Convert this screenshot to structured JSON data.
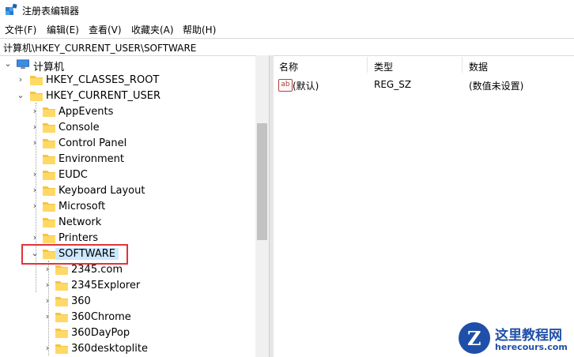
{
  "window": {
    "title": "注册表编辑器"
  },
  "menu": [
    "文件(F)",
    "编辑(E)",
    "查看(V)",
    "收藏夹(A)",
    "帮助(H)"
  ],
  "address": "计算机\\HKEY_CURRENT_USER\\SOFTWARE",
  "tree": {
    "root": "计算机",
    "hkcr": "HKEY_CLASSES_ROOT",
    "hkcu": "HKEY_CURRENT_USER",
    "hkcu_children": [
      "AppEvents",
      "Console",
      "Control Panel",
      "Environment",
      "EUDC",
      "Keyboard Layout",
      "Microsoft",
      "Network",
      "Printers"
    ],
    "selected": "SOFTWARE",
    "software_children": [
      "2345.com",
      "2345Explorer",
      "360",
      "360Chrome",
      "360DayPop",
      "360desktoplite"
    ]
  },
  "list": {
    "headers": {
      "name": "名称",
      "type": "类型",
      "data": "数据"
    },
    "rows": [
      {
        "name": "(默认)",
        "type": "REG_SZ",
        "data": "(数值未设置)",
        "icon": "ab-icon"
      }
    ]
  },
  "watermark": {
    "name": "这里教程网",
    "url": "herecours.com",
    "logo_letter": "Z"
  },
  "colors": {
    "selection": "#cce8ff",
    "highlight_box": "#e0343a",
    "folder": "#f5c542",
    "watermark": "#1f4fa8"
  }
}
